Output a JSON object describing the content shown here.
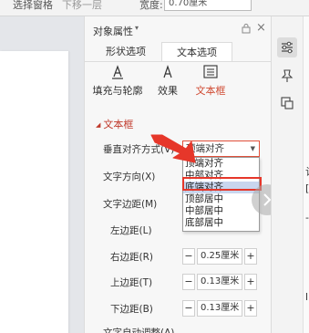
{
  "toolbar": {
    "item1": "选择窗格",
    "item2": "下移一层",
    "size_label": "宽度:",
    "size_value": "0.70厘米"
  },
  "panel": {
    "title": "对象属性",
    "tabs": [
      {
        "label": "形状选项"
      },
      {
        "label": "文本选项"
      }
    ],
    "subtabs": [
      {
        "label": "填充与轮廓"
      },
      {
        "label": "效果"
      },
      {
        "label": "文本框"
      }
    ],
    "section_title": "文本框",
    "fields": {
      "valign_label": "垂直对齐方式(V)",
      "valign_value": "顶端对齐",
      "direction_label": "文字方向(X)",
      "margin_label": "文字边距(M)",
      "left_label": "左边距(L)",
      "right_label": "右边距(R)",
      "right_value": "0.25厘米",
      "top_label": "上边距(T)",
      "top_value": "0.13厘米",
      "bottom_label": "下边距(B)",
      "bottom_value": "0.13厘米",
      "autofit_label": "文字自动调整(A)"
    },
    "dropdown_options": [
      "顶端对齐",
      "中部对齐",
      "底端对齐",
      "顶部居中",
      "中部居中",
      "底部居中"
    ],
    "highlighted_option": "底端对齐",
    "minus": "−",
    "plus": "+"
  },
  "rail": {
    "edge_chars": [
      "认",
      "[",
      "-",
      "l"
    ]
  },
  "colors": {
    "accent": "#d04a32",
    "annotation": "#e6372a",
    "highlight": "#c9d6ee"
  }
}
